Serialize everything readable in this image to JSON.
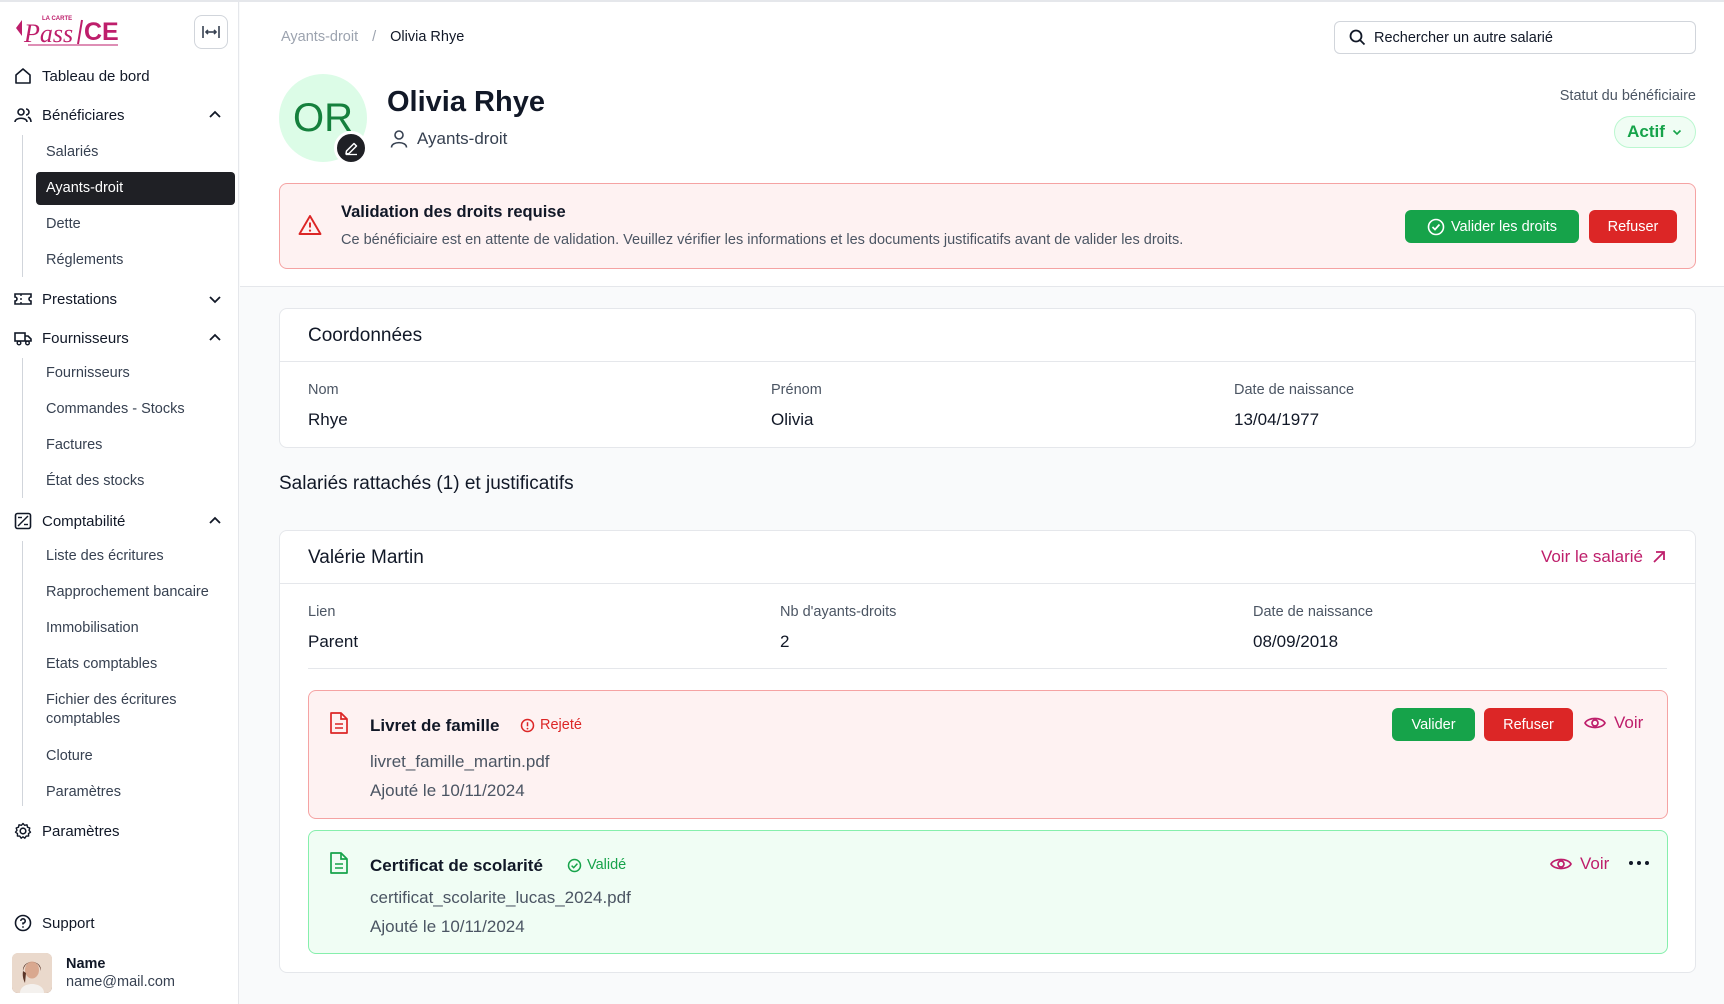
{
  "brand": {
    "logo_text": "LA CARTE Pass CE"
  },
  "sidebar": {
    "items": [
      {
        "label": "Tableau de bord"
      },
      {
        "label": "Bénéficiares"
      },
      {
        "label": "Prestations"
      },
      {
        "label": "Fournisseurs"
      },
      {
        "label": "Comptabilité"
      },
      {
        "label": "Paramètres"
      }
    ],
    "beneficiaires_sub": [
      "Salariés",
      "Ayants-droit",
      "Dette",
      "Réglements"
    ],
    "fournisseurs_sub": [
      "Fournisseurs",
      "Commandes - Stocks",
      "Factures",
      "État des stocks"
    ],
    "comptabilite_sub": [
      "Liste des écritures",
      "Rapprochement bancaire",
      "Immobilisation",
      "Etats comptables",
      "Fichier des écritures comptables",
      "Cloture",
      "Paramètres"
    ],
    "support": "Support",
    "user": {
      "name": "Name",
      "email": "name@mail.com"
    }
  },
  "breadcrumb": {
    "parent": "Ayants-droit",
    "separator": "/",
    "current": "Olivia Rhye"
  },
  "search": {
    "placeholder": "Rechercher un autre salarié"
  },
  "profile": {
    "initials": "OR",
    "name": "Olivia Rhye",
    "role": "Ayants-droit",
    "status_label": "Statut du bénéficiaire",
    "status_value": "Actif"
  },
  "alert": {
    "title": "Validation des droits requise",
    "text": "Ce bénéficiaire est en attente de validation. Veuillez vérifier les informations et les documents justificatifs avant de valider les droits.",
    "validate_label": "Valider les droits",
    "refuse_label": "Refuser"
  },
  "coordonnees": {
    "title": "Coordonnées",
    "fields": [
      {
        "label": "Nom",
        "value": "Rhye"
      },
      {
        "label": "Prénom",
        "value": "Olivia"
      },
      {
        "label": "Date de naissance",
        "value": "13/04/1977"
      }
    ]
  },
  "attached": {
    "section_title": "Salariés rattachés (1) et justificatifs",
    "employee": {
      "name": "Valérie Martin",
      "link_label": "Voir le salarié",
      "fields": [
        {
          "label": "Lien",
          "value": "Parent"
        },
        {
          "label": "Nb d'ayants-droits",
          "value": "2"
        },
        {
          "label": "Date de naissance",
          "value": "08/09/2018"
        }
      ]
    },
    "documents": [
      {
        "name": "Livret de famille",
        "status": "Rejeté",
        "file": "livret_famille_martin.pdf",
        "added": "Ajouté le 10/11/2024",
        "validate_label": "Valider",
        "refuse_label": "Refuser",
        "view_label": "Voir"
      },
      {
        "name": "Certificat de scolarité",
        "status": "Validé",
        "file": "certificat_scolarite_lucas_2024.pdf",
        "added": "Ajouté le 10/11/2024",
        "view_label": "Voir"
      }
    ]
  },
  "colors": {
    "brand_pink": "#be1e6b",
    "green": "#16a34a",
    "red": "#dc2626",
    "active_nav": "#1f2025"
  }
}
